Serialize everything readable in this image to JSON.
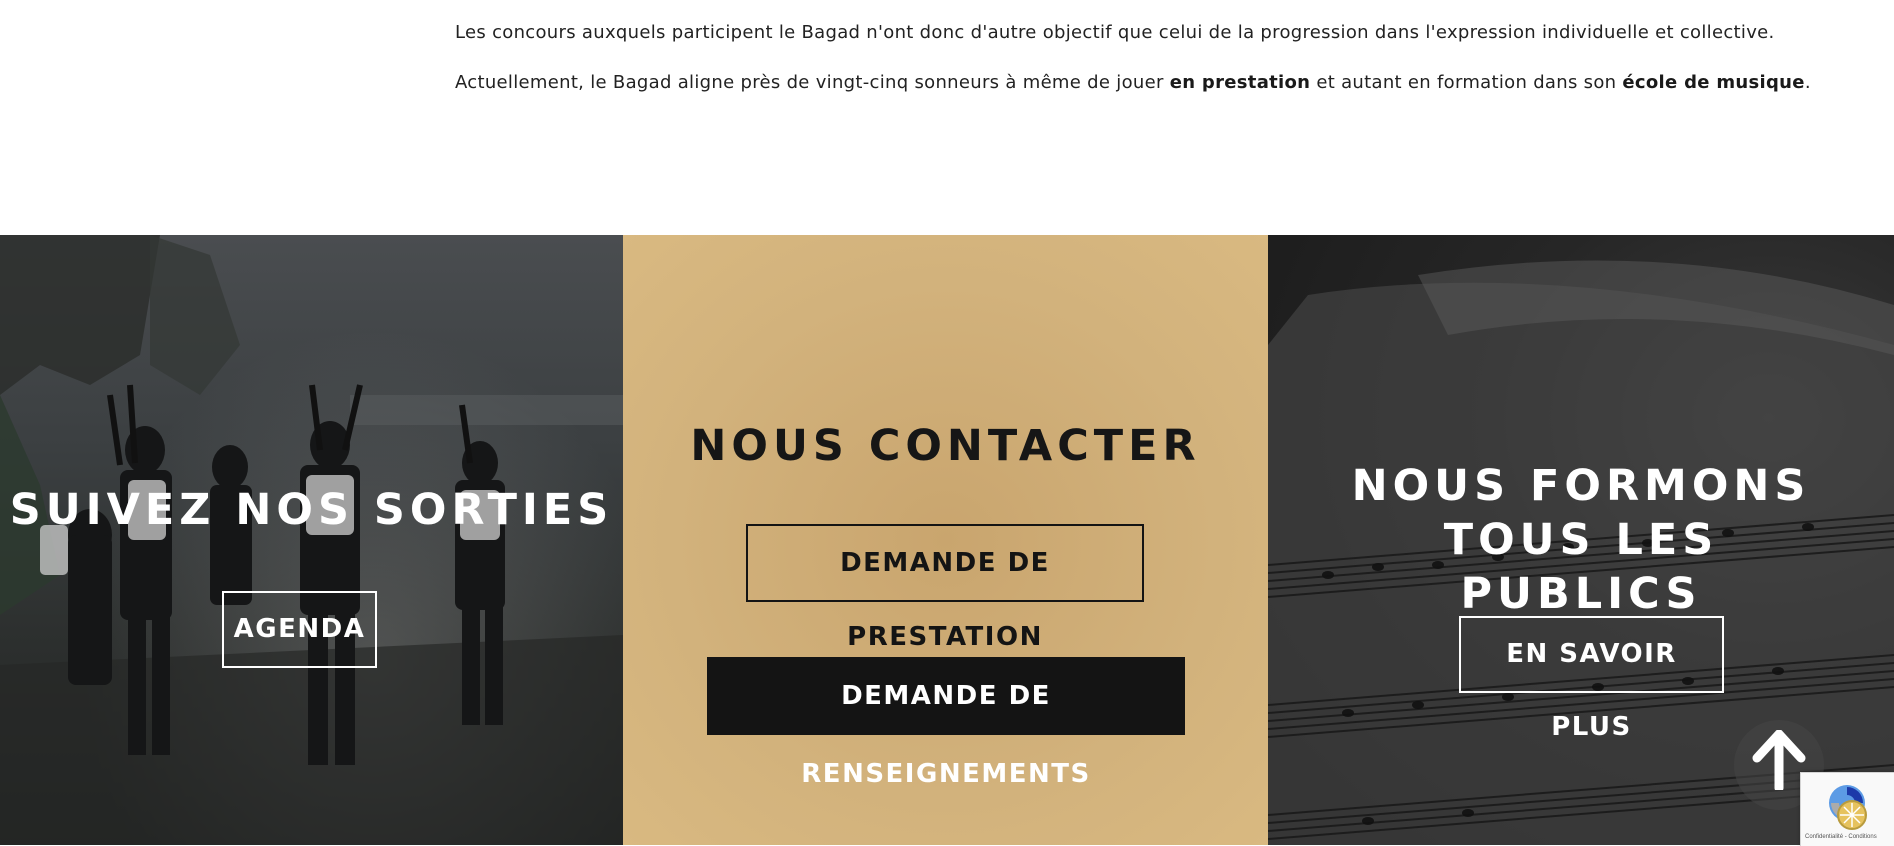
{
  "intro": {
    "line1": "Les concours auxquels participent le Bagad n'ont donc d'autre objectif que celui de la progression dans l'expression individuelle et collective.",
    "line2_start": "Actuellement, le Bagad aligne près de vingt-cinq sonneurs à même de jouer ",
    "line2_bold1": "en prestation",
    "line2_mid": " et autant en formation dans son ",
    "line2_bold2": "école de musique",
    "line2_end": "."
  },
  "panels": {
    "left": {
      "heading": "SUIVEZ NOS SORTIES",
      "button": "AGENDA"
    },
    "middle": {
      "heading": "NOUS CONTACTER",
      "button_outline": "DEMANDE DE PRESTATION",
      "button_filled": "DEMANDE DE RENSEIGNEMENTS",
      "bg_color": "#d2b27c"
    },
    "right": {
      "heading_line1": "NOUS FORMONS TOUS LES",
      "heading_line2": "PUBLICS",
      "button": "EN SAVOIR PLUS"
    }
  },
  "scroll_top": {
    "icon": "arrow-up-icon"
  },
  "recaptcha": {
    "text": "Confidentialité - Conditions",
    "icon": "recaptcha-logo-icon"
  }
}
